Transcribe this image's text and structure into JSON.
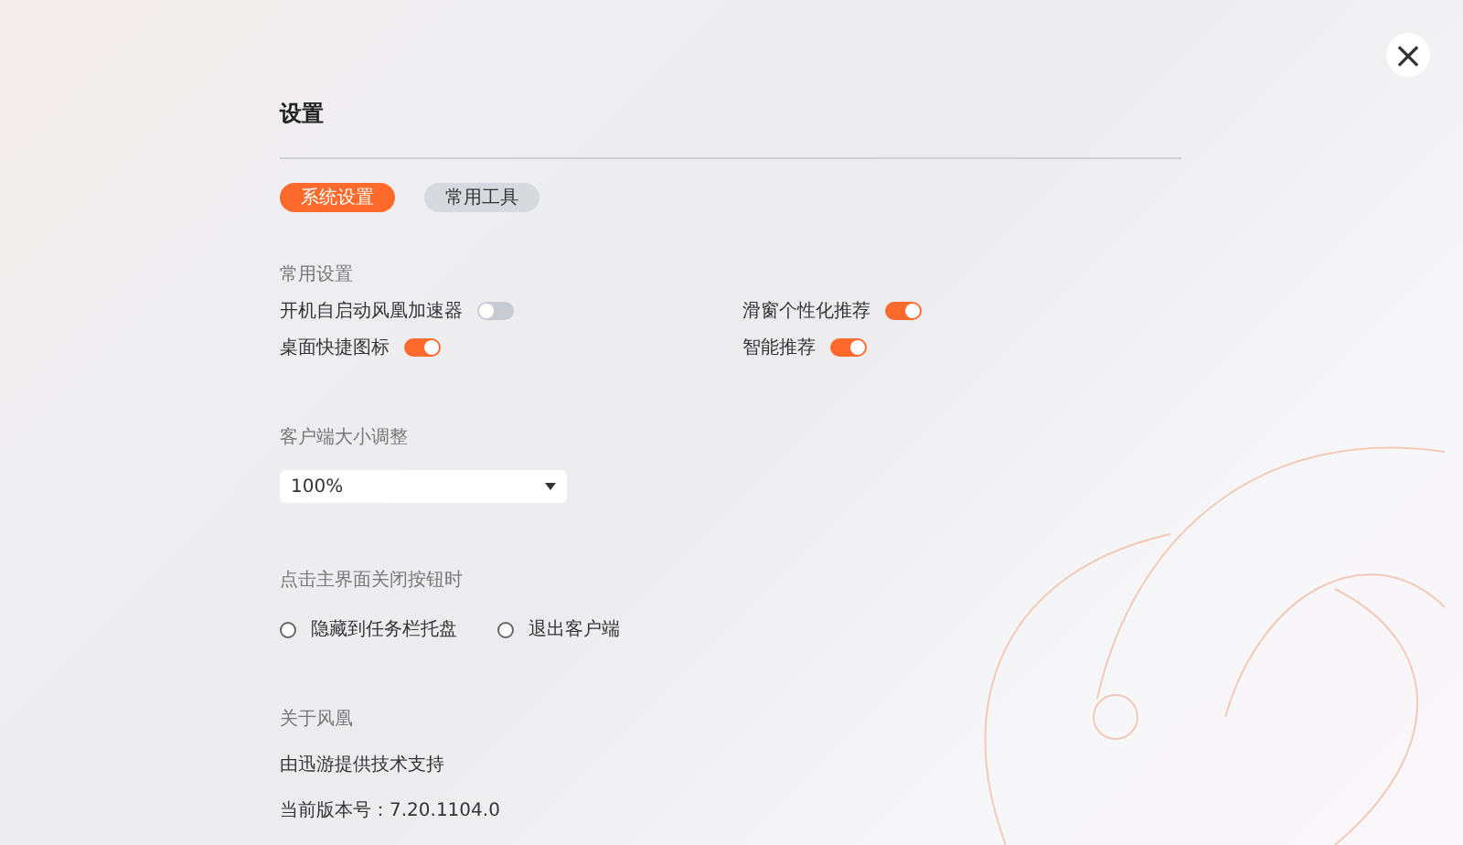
{
  "title": "设置",
  "close_button": {
    "label": "×"
  },
  "tabs": [
    {
      "label": "系统设置",
      "selected": true
    },
    {
      "label": "常用工具",
      "selected": false
    }
  ],
  "general": {
    "heading": "常用设置",
    "toggles": [
      {
        "label": "开机自启动风凰加速器",
        "on": false
      },
      {
        "label": "滑窗个性化推荐",
        "on": true
      },
      {
        "label": "桌面快捷图标",
        "on": true
      },
      {
        "label": "智能推荐",
        "on": true
      }
    ]
  },
  "size": {
    "heading": "客户端大小调整",
    "value": "100%"
  },
  "close_action": {
    "heading": "点击主界面关闭按钮时",
    "options": [
      {
        "label": "隐藏到任务栏托盘",
        "selected": false
      },
      {
        "label": "退出客户端",
        "selected": false
      }
    ]
  },
  "about": {
    "heading": "关于风凰",
    "lines": [
      "由迅游提供技术支持",
      "当前版本号：7.20.1104.0"
    ]
  }
}
